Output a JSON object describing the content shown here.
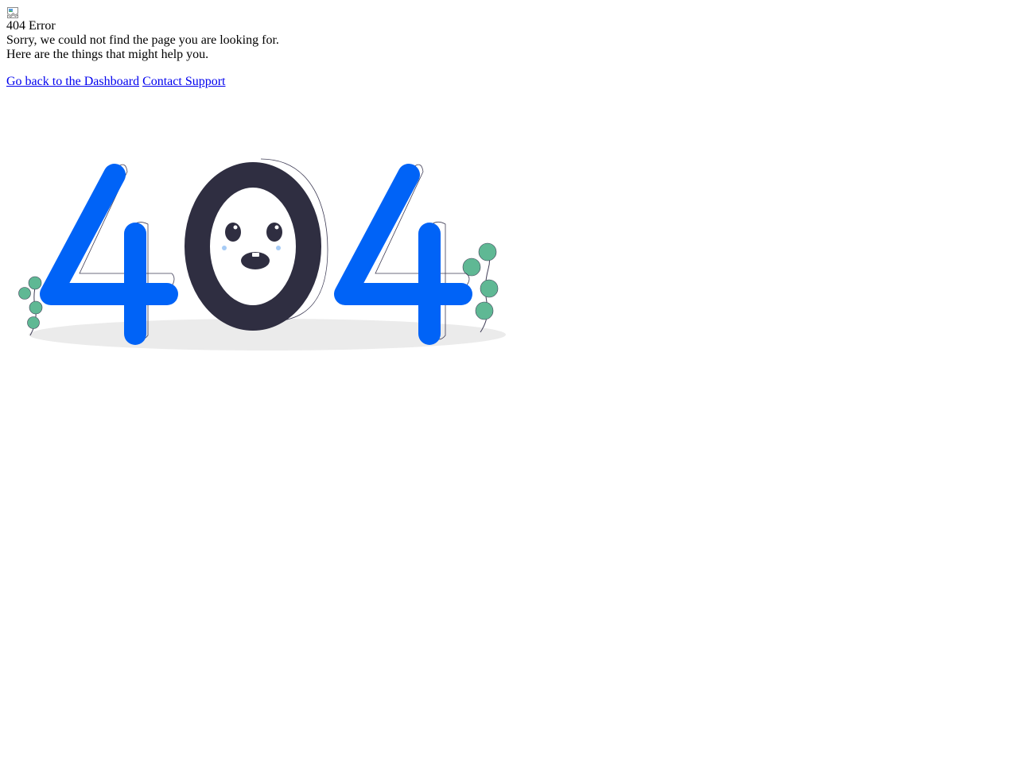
{
  "error": {
    "title": "404 Error",
    "message_line1": "Sorry, we could not find the page you are looking for.",
    "message_line2": "Here are the things that might help you."
  },
  "links": {
    "dashboard": "Go back to the Dashboard",
    "support": "Contact Support"
  },
  "illustration": {
    "text": "404",
    "colors": {
      "digit_four": "#0063f7",
      "digit_zero": "#2f2e41",
      "leaf": "#5fb894",
      "shadow": "#ebebeb"
    }
  },
  "icons": {
    "broken_image": "broken-image-icon"
  }
}
